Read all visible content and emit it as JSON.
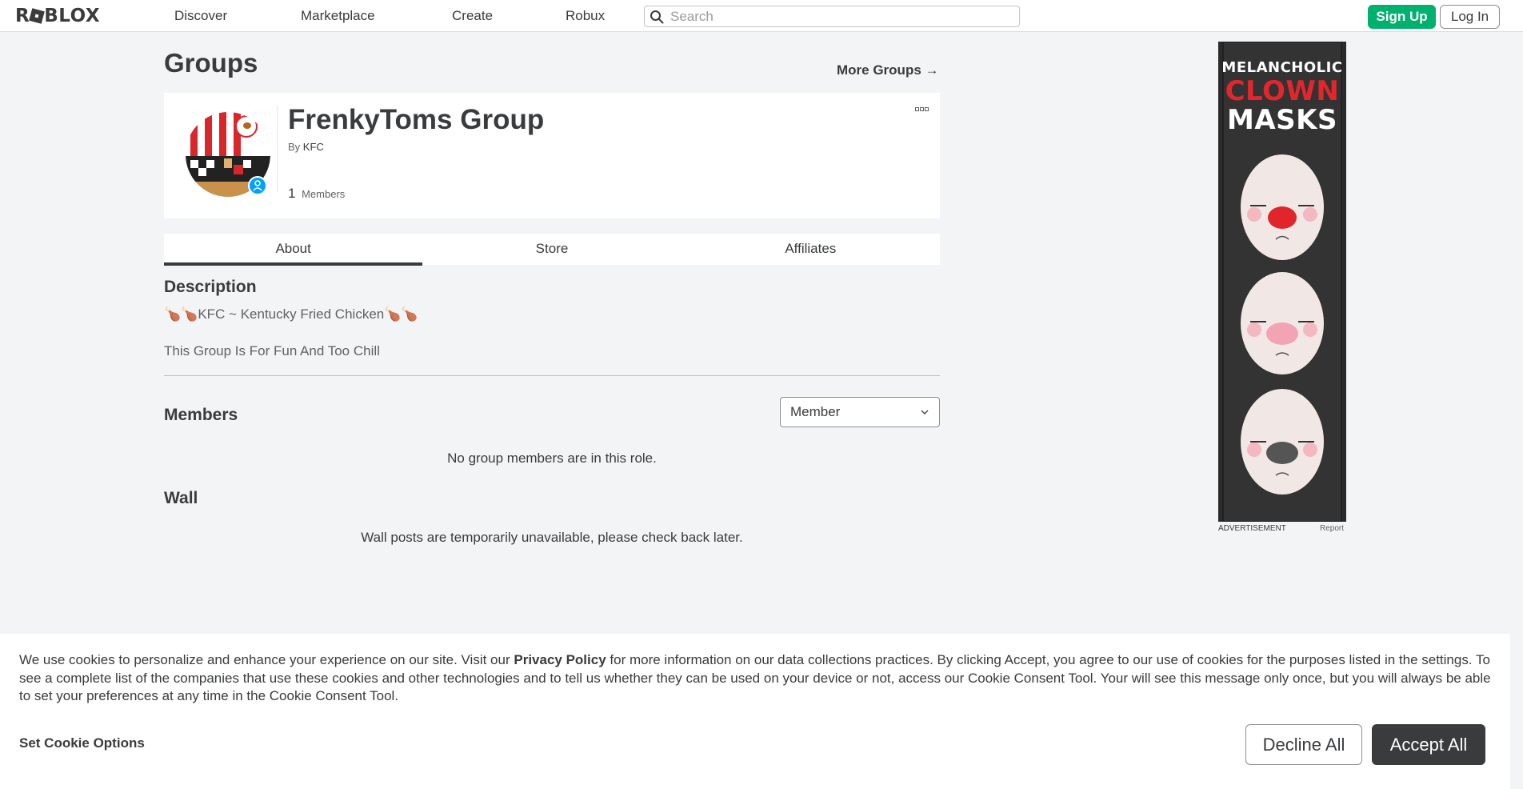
{
  "nav": {
    "logo": "ROBLOX",
    "links": [
      "Discover",
      "Marketplace",
      "Create",
      "Robux"
    ],
    "search_placeholder": "Search",
    "signup": "Sign Up",
    "login": "Log In"
  },
  "page": {
    "title": "Groups",
    "more_groups": "More Groups →"
  },
  "group": {
    "name": "FrenkyToms Group",
    "by_label": "By",
    "owner": "KFC",
    "member_count": "1",
    "members_label": "Members"
  },
  "tabs": [
    "About",
    "Store",
    "Affiliates"
  ],
  "description": {
    "heading": "Description",
    "line1": "🍗🍗KFC ~ Kentucky Fried Chicken🍗🍗",
    "line2": "This Group Is For Fun And Too Chill"
  },
  "members": {
    "heading": "Members",
    "role_selected": "Member",
    "empty": "No group members are in this role."
  },
  "wall": {
    "heading": "Wall",
    "message": "Wall posts are temporarily unavailable, please check back later."
  },
  "ad": {
    "line1": "MELANCHOLIC",
    "line2": "CLOWN",
    "line3": "MASKS",
    "label": "ADVERTISEMENT",
    "report": "Report"
  },
  "cookie": {
    "text_before": "We use cookies to personalize and enhance your experience on our site. Visit our ",
    "link": "Privacy Policy",
    "text_after": " for more information on our data collections practices. By clicking Accept, you agree to our use of cookies for the purposes listed in the settings. To see a complete list of the companies that use these cookies and other technologies and to tell us whether they can be used on your device or not, access our Cookie Consent Tool. Your will see this message only once, but you will always be able to set your preferences at any time in the Cookie Consent Tool.",
    "set_options": "Set Cookie Options",
    "decline": "Decline All",
    "accept": "Accept All"
  },
  "colors": {
    "signup_green": "#00b06f",
    "accept_dark": "#393b3d",
    "ad_red": "#e3262b"
  }
}
